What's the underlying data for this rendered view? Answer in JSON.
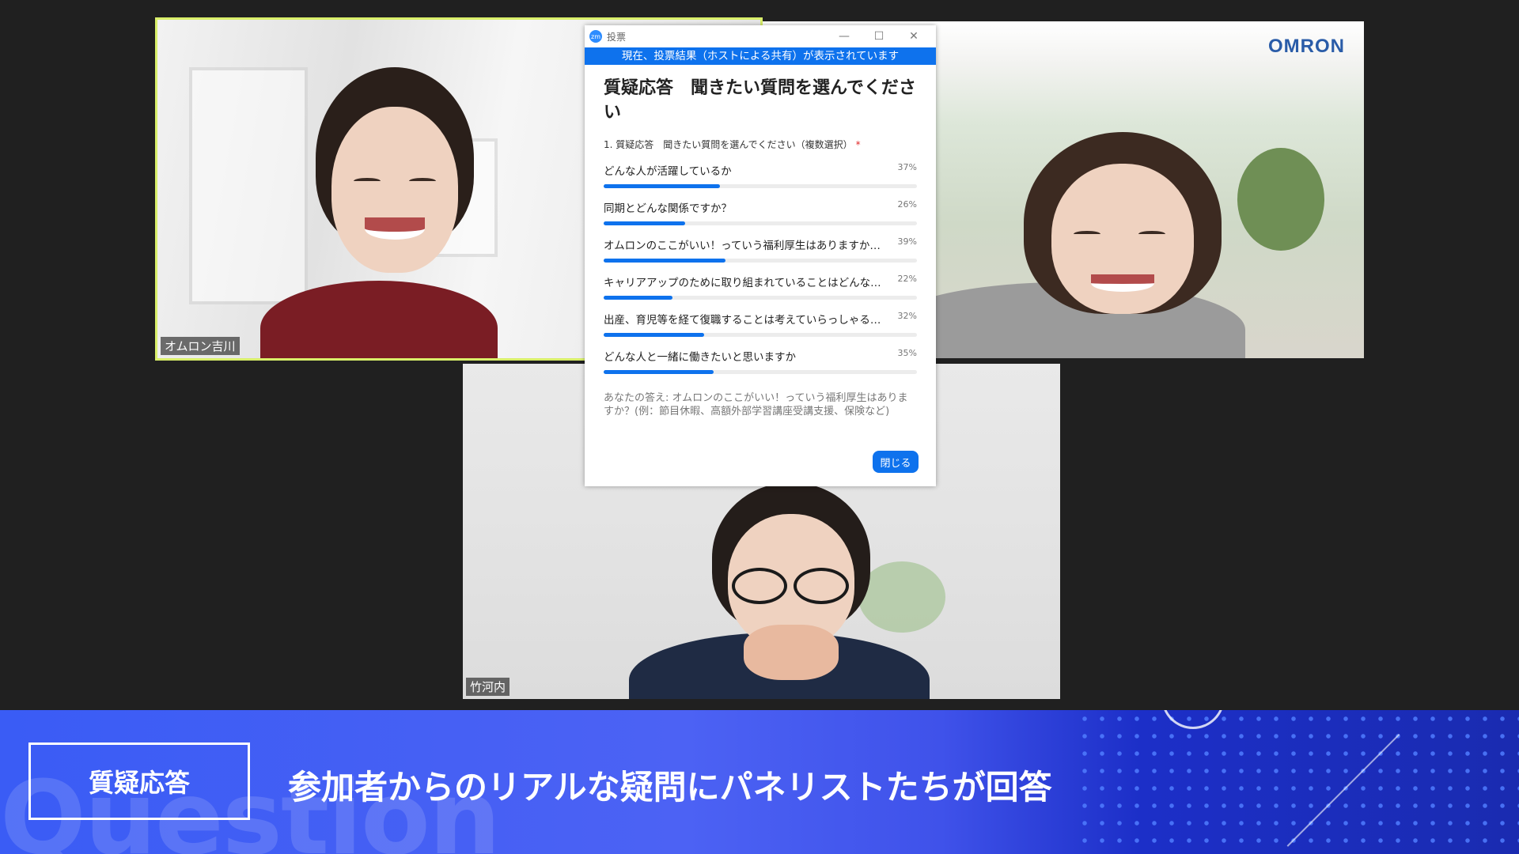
{
  "participants": [
    {
      "name": "オムロン吉川"
    },
    {
      "name": "",
      "logo": "OMRON"
    },
    {
      "name": "竹河内"
    }
  ],
  "poll": {
    "window_title": "投票",
    "app_icon_text": "zm",
    "window_controls": [
      "—",
      "☐",
      "✕"
    ],
    "banner": "現在、投票結果（ホストによる共有）が表示されています",
    "heading": "質疑応答　聞きたい質問を選んでください",
    "question": "1. 質疑応答　聞きたい質問を選んでください（複数選択）",
    "required_mark": "*",
    "options": [
      {
        "text": "どんな人が活躍しているか",
        "percent_label": "37%",
        "percent": 37
      },
      {
        "text": "同期とどんな関係ですか？",
        "percent_label": "26%",
        "percent": 26
      },
      {
        "text": "オムロンのここがいい！っていう福利厚生はありますか？(...",
        "percent_label": "39%",
        "percent": 39
      },
      {
        "text": "キャリアアップのために取り組まれていることはどんなことがあ...",
        "percent_label": "22%",
        "percent": 22
      },
      {
        "text": "出産、育児等を経て復職することは考えていらっしゃるか...",
        "percent_label": "32%",
        "percent": 32
      },
      {
        "text": "どんな人と一緒に働きたいと思いますか",
        "percent_label": "35%",
        "percent": 35
      }
    ],
    "your_answer": "あなたの答え: オムロンのここがいい！っていう福利厚生はありますか？(例：節目休暇、高額外部学習講座受講支援、保険など)",
    "close_label": "閉じる"
  },
  "banner": {
    "tag": "質疑応答",
    "caption": "参加者からのリアルな疑問にパネリストたちが回答",
    "background_word": "Question"
  },
  "colors": {
    "accent": "#0e72ed",
    "active_speaker_border": "#d9ef6a",
    "banner_blue": "#3a5cf5"
  }
}
